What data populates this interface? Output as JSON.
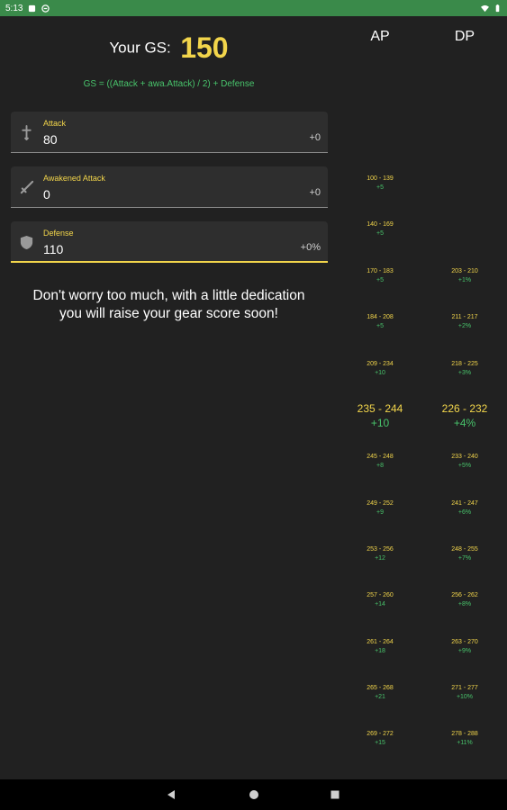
{
  "status": {
    "time": "5:13"
  },
  "score": {
    "label": "Your GS:",
    "value": "150",
    "formula": "GS = ((Attack + awa.Attack) / 2) + Defense"
  },
  "fields": [
    {
      "label": "Attack",
      "value": "80",
      "suffix": "+0",
      "icon": "sword-cross-icon"
    },
    {
      "label": "Awakened Attack",
      "value": "0",
      "suffix": "+0",
      "icon": "awakened-sword-icon"
    },
    {
      "label": "Defense",
      "value": "110",
      "suffix": "+0%",
      "icon": "shield-icon"
    }
  ],
  "message": {
    "line1": "Don't worry too much, with a little dedication",
    "line2": "you will raise your gear score soon!"
  },
  "table": {
    "ap_header": "AP",
    "dp_header": "DP",
    "ap": [
      {
        "range": "100 - 139",
        "bonus": "+5"
      },
      {
        "range": "140 - 169",
        "bonus": "+5"
      },
      {
        "range": "170 - 183",
        "bonus": "+5"
      },
      {
        "range": "184 - 208",
        "bonus": "+5"
      },
      {
        "range": "209 - 234",
        "bonus": "+10"
      },
      {
        "range": "235 - 244",
        "bonus": "+10"
      },
      {
        "range": "245 - 248",
        "bonus": "+8"
      },
      {
        "range": "249 - 252",
        "bonus": "+9"
      },
      {
        "range": "253 - 256",
        "bonus": "+12"
      },
      {
        "range": "257 - 260",
        "bonus": "+14"
      },
      {
        "range": "261 - 264",
        "bonus": "+18"
      },
      {
        "range": "265 - 268",
        "bonus": "+21"
      },
      {
        "range": "269 - 272",
        "bonus": "+15"
      }
    ],
    "dp": [
      {
        "range": "",
        "bonus": ""
      },
      {
        "range": "",
        "bonus": ""
      },
      {
        "range": "203 - 210",
        "bonus": "+1%"
      },
      {
        "range": "211 - 217",
        "bonus": "+2%"
      },
      {
        "range": "218 - 225",
        "bonus": "+3%"
      },
      {
        "range": "226 - 232",
        "bonus": "+4%"
      },
      {
        "range": "233 - 240",
        "bonus": "+5%"
      },
      {
        "range": "241 - 247",
        "bonus": "+6%"
      },
      {
        "range": "248 - 255",
        "bonus": "+7%"
      },
      {
        "range": "256 - 262",
        "bonus": "+8%"
      },
      {
        "range": "263 - 270",
        "bonus": "+9%"
      },
      {
        "range": "271 - 277",
        "bonus": "+10%"
      },
      {
        "range": "278 - 288",
        "bonus": "+11%"
      }
    ]
  },
  "colors": {
    "status_bar": "#3a8a4a",
    "accent_yellow": "#f2d54b",
    "accent_green": "#48c36b",
    "background": "#212121"
  }
}
